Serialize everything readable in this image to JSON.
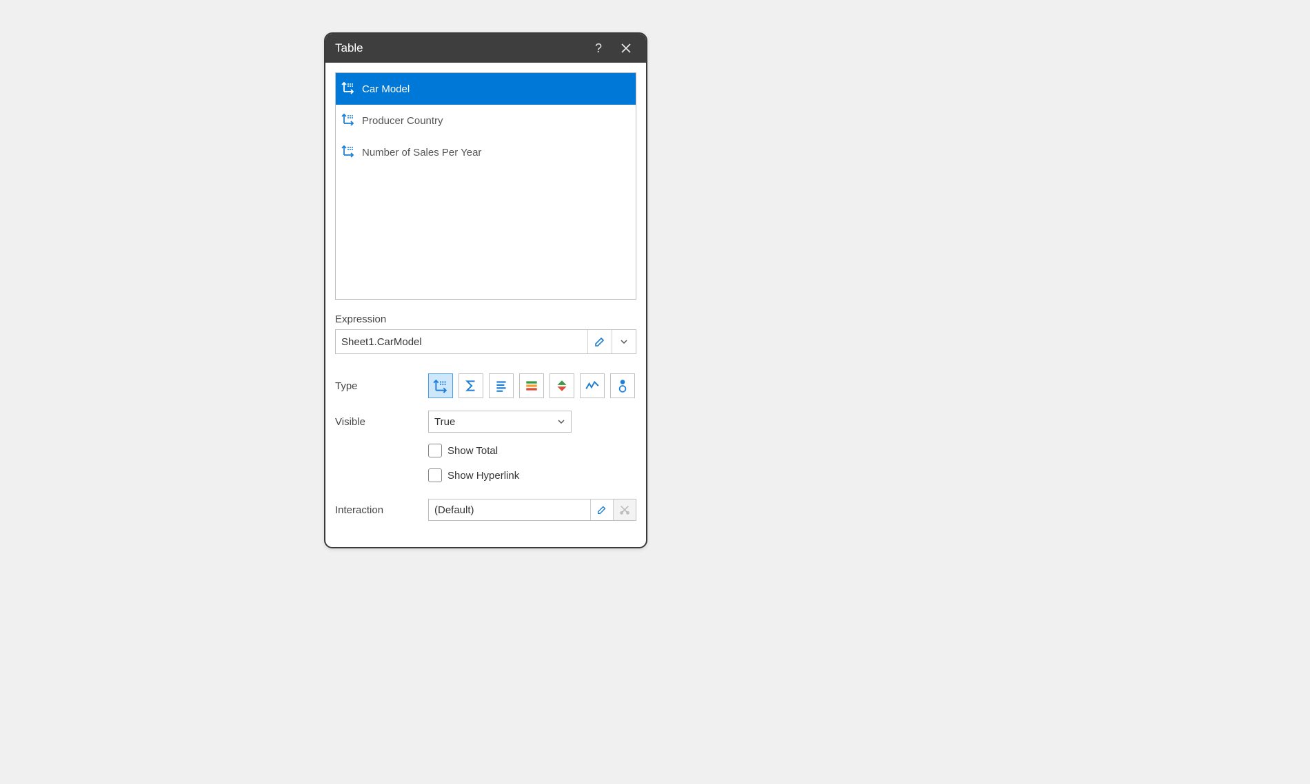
{
  "dialog": {
    "title": "Table"
  },
  "fields": {
    "items": [
      {
        "label": "Car Model",
        "selected": true
      },
      {
        "label": "Producer Country",
        "selected": false
      },
      {
        "label": "Number of Sales Per Year",
        "selected": false
      }
    ]
  },
  "expression": {
    "label": "Expression",
    "value": "Sheet1.CarModel"
  },
  "type": {
    "label": "Type",
    "selected_index": 0,
    "options": [
      "dimension",
      "measure",
      "text-align",
      "color-scale",
      "sort-indicator",
      "sparkline",
      "delta-bubble"
    ]
  },
  "visible": {
    "label": "Visible",
    "value": "True"
  },
  "checkboxes": {
    "show_total": {
      "label": "Show Total",
      "checked": false
    },
    "show_hyperlink": {
      "label": "Show Hyperlink",
      "checked": false
    }
  },
  "interaction": {
    "label": "Interaction",
    "value": "(Default)"
  }
}
